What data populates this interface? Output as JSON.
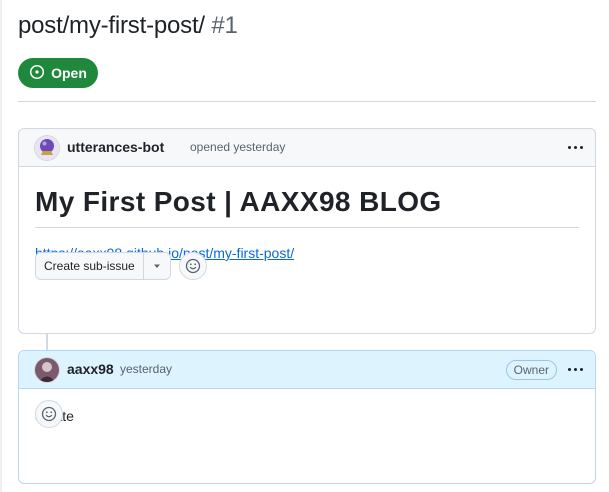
{
  "issue": {
    "title": "post/my-first-post/",
    "number": "#1",
    "state": "Open",
    "colors": {
      "open": "#1f883d",
      "link": "#0969da",
      "owner_highlight": "#ddf4ff"
    }
  },
  "comments": [
    {
      "author": "utterances-bot",
      "meta": "opened yesterday",
      "avatar_icon": "crystal-ball-avatar",
      "body": {
        "heading": "My First Post | AAXX98 BLOG",
        "link": "https://aaxx98.github.io/post/my-first-post/",
        "action_button": "Create sub-issue"
      }
    },
    {
      "author": "aaxx98",
      "meta": "yesterday",
      "badge": "Owner",
      "avatar_icon": "user-avatar",
      "body": {
        "text": "create"
      }
    }
  ]
}
